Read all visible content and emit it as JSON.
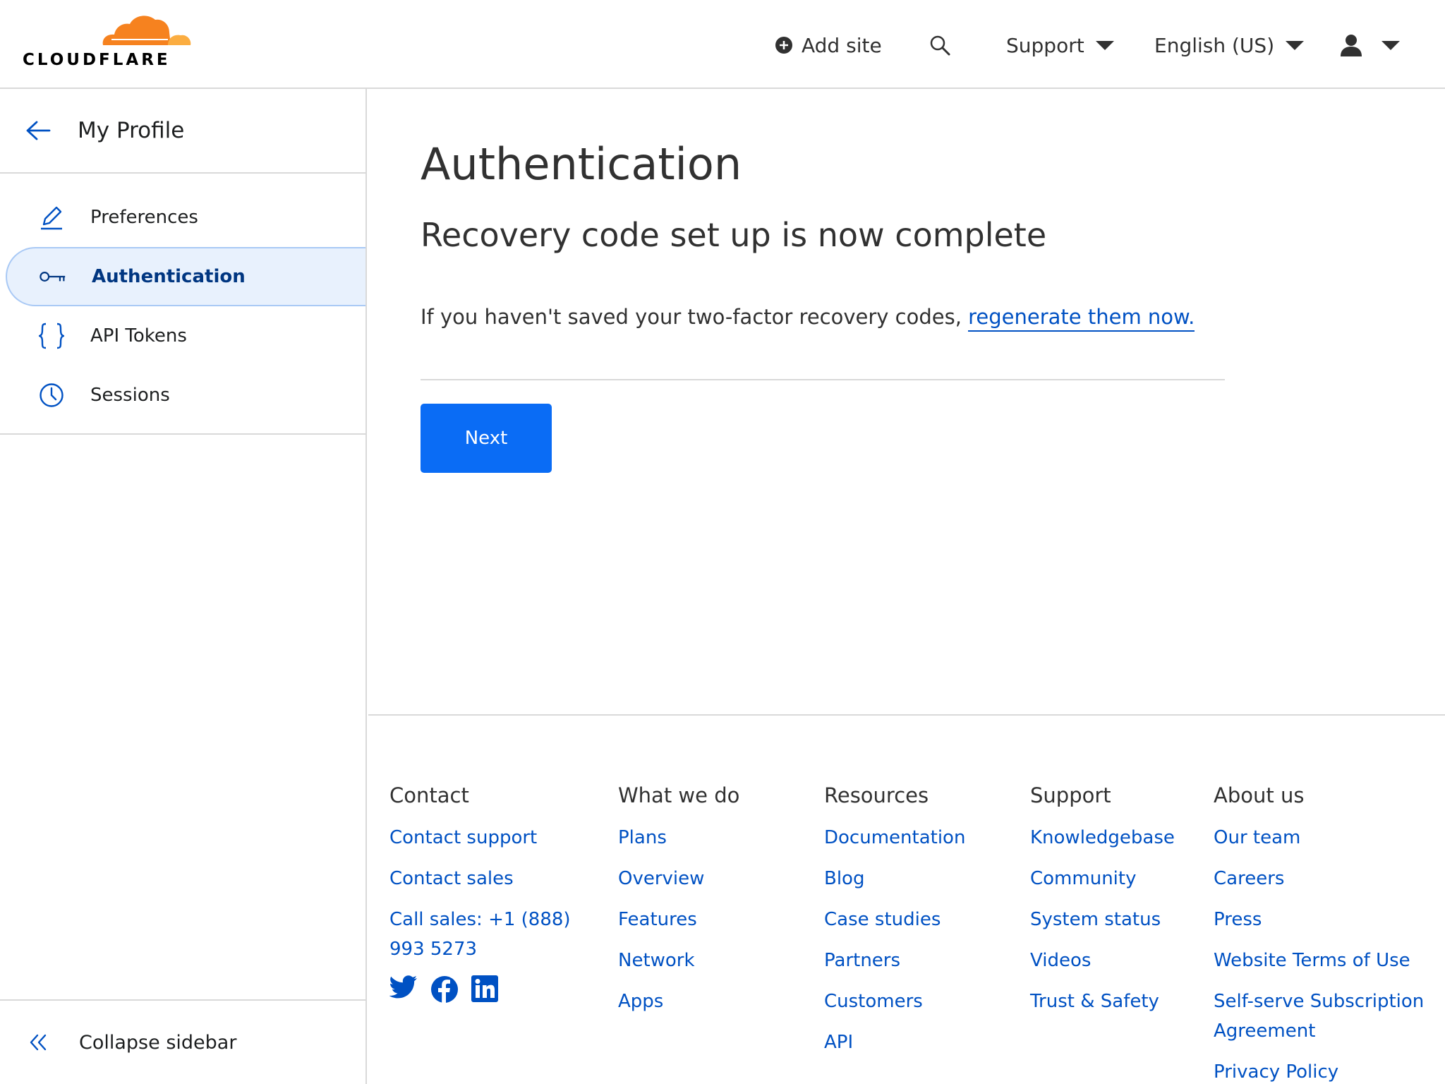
{
  "header": {
    "logo_text": "CLOUDFLARE",
    "add_site": "Add site",
    "support": "Support",
    "language": "English (US)"
  },
  "sidebar": {
    "title": "My Profile",
    "items": [
      {
        "label": "Preferences",
        "icon": "pencil-icon"
      },
      {
        "label": "Authentication",
        "icon": "key-icon",
        "active": true
      },
      {
        "label": "API Tokens",
        "icon": "braces-icon"
      },
      {
        "label": "Sessions",
        "icon": "clock-icon"
      }
    ],
    "collapse": "Collapse sidebar"
  },
  "main": {
    "title": "Authentication",
    "subtitle": "Recovery code set up is now complete",
    "info_prefix": "If you haven't saved your two-factor recovery codes, ",
    "info_link": "regenerate them now.",
    "next_button": "Next"
  },
  "footer": {
    "contact": {
      "heading": "Contact",
      "links": [
        "Contact support",
        "Contact sales",
        "Call sales: +1 (888) 993 5273"
      ]
    },
    "what_we_do": {
      "heading": "What we do",
      "links": [
        "Plans",
        "Overview",
        "Features",
        "Network",
        "Apps"
      ]
    },
    "resources": {
      "heading": "Resources",
      "links": [
        "Documentation",
        "Blog",
        "Case studies",
        "Partners",
        "Customers",
        "API"
      ]
    },
    "support": {
      "heading": "Support",
      "links": [
        "Knowledgebase",
        "Community",
        "System status",
        "Videos",
        "Trust & Safety"
      ]
    },
    "about": {
      "heading": "About us",
      "links": [
        "Our team",
        "Careers",
        "Press",
        "Website Terms of Use",
        "Self-serve Subscription Agreement",
        "Privacy Policy"
      ]
    },
    "socials": [
      "twitter-icon",
      "facebook-icon",
      "linkedin-icon"
    ]
  },
  "colors": {
    "brand_orange": "#f6821f",
    "link_blue": "#0051c3",
    "button_blue": "#0a6cf5",
    "active_bg": "#e8f1fd"
  }
}
